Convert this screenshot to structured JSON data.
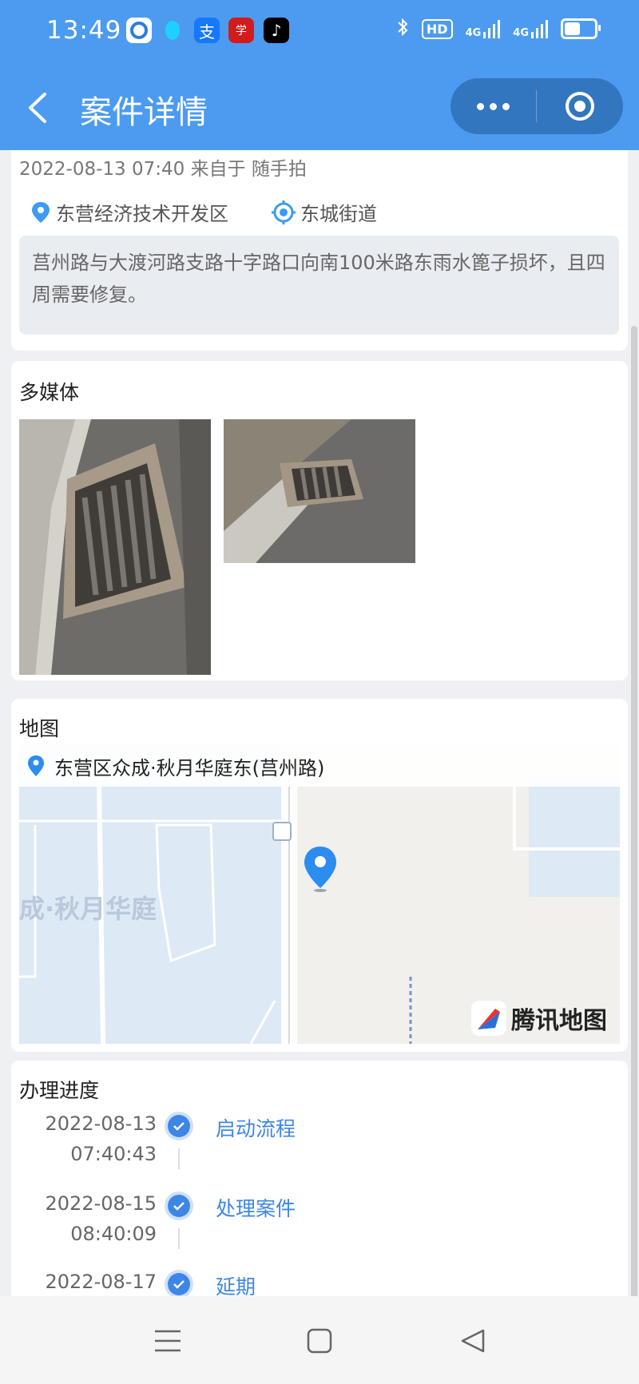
{
  "status_bar": {
    "time": "13:49",
    "hd_label": "HD",
    "signal_1": "4G",
    "signal_2": "4G"
  },
  "header": {
    "back_icon": "chevron-left-icon",
    "title": "案件详情",
    "more_icon": "more-dots-icon",
    "close_icon": "target-circle-icon"
  },
  "case": {
    "meta": "2022-08-13 07:40 来自于 随手拍",
    "district": "东营经济技术开发区",
    "street": "东城街道",
    "description": "莒州路与大渡河路支路十字路口向南100米路东雨水篦子损坏，且四周需要修复。"
  },
  "media": {
    "title": "多媒体",
    "photos": [
      "drain-grate-photo-1",
      "drain-grate-photo-2"
    ]
  },
  "map": {
    "title": "地图",
    "address": "东营区众成·秋月华庭东(莒州路)",
    "area_label": "成·秋月华庭",
    "provider": "腾讯地图"
  },
  "progress": {
    "title": "办理进度",
    "steps": [
      {
        "date": "2022-08-13",
        "time": "07:40:43",
        "label": "启动流程"
      },
      {
        "date": "2022-08-15",
        "time": "08:40:09",
        "label": "处理案件"
      },
      {
        "date": "2022-08-17",
        "time": "",
        "label": "延期"
      }
    ]
  },
  "colors": {
    "header": "#4c9bf0",
    "accent": "#3d86e8",
    "capsule": "#3376c0"
  },
  "system_nav": {
    "menu_icon": "menu-icon",
    "home_icon": "home-square-icon",
    "back_icon": "back-triangle-icon"
  }
}
